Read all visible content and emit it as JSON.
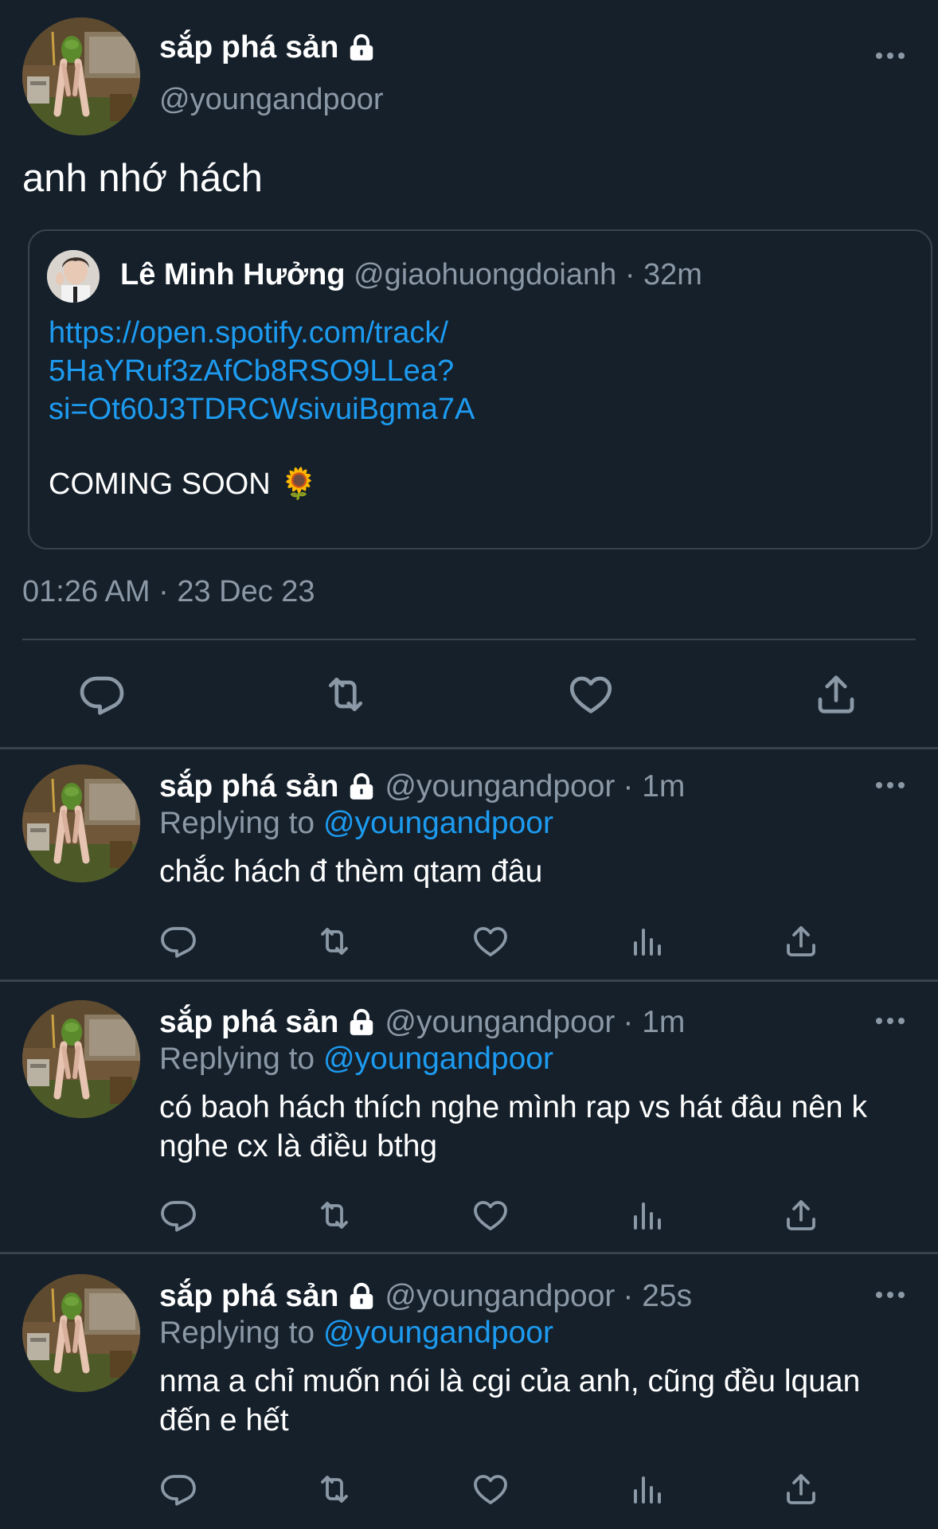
{
  "main_tweet": {
    "author_name": "sắp phá sản",
    "author_handle": "@youngandpoor",
    "text": "anh nhớ hách",
    "timestamp": "01:26 AM · 23 Dec 23",
    "quoted": {
      "name": "Lê Minh Hưởng",
      "handle": "@giaohuongdoianh",
      "time": "· 32m",
      "link_lines": [
        "https://open.spotify.com/track/",
        "5HaYRuf3zAfCb8RSO9LLea?",
        "si=Ot60J3TDRCWsivuiBgma7A"
      ],
      "text": "COMING SOON",
      "emoji": "🌻"
    }
  },
  "replies": [
    {
      "name": "sắp phá sản",
      "handle": "@youngandpoor",
      "time": "· 1m",
      "replying_prefix": "Replying to",
      "replying_to": "@youngandpoor",
      "text": "chắc hách đ thèm qtam đâu"
    },
    {
      "name": "sắp phá sản",
      "handle": "@youngandpoor",
      "time": "· 1m",
      "replying_prefix": "Replying to",
      "replying_to": "@youngandpoor",
      "text": "có baoh hách thích nghe mình rap vs hát đâu nên k nghe cx là điều bthg"
    },
    {
      "name": "sắp phá sản",
      "handle": "@youngandpoor",
      "time": "· 25s",
      "replying_prefix": "Replying to",
      "replying_to": "@youngandpoor",
      "text": "nma a chỉ muốn nói là cgi của anh, cũng đều lquan đến e hết"
    }
  ],
  "colors": {
    "background": "#15202b",
    "text": "#ffffff",
    "secondary": "#8b98a5",
    "link": "#1d9bf0",
    "divider": "#38444d"
  },
  "icons": [
    "lock-icon",
    "more-icon",
    "reply-icon",
    "retweet-icon",
    "like-icon",
    "share-icon",
    "analytics-icon"
  ]
}
